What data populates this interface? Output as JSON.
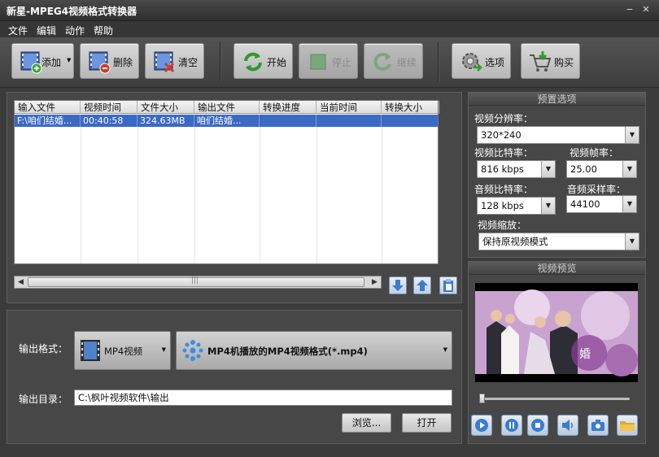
{
  "window": {
    "title": "新星-MPEG4视频格式转换器"
  },
  "menu": [
    "文件",
    "编辑",
    "动作",
    "帮助"
  ],
  "toolbar": {
    "add": "添加",
    "delete": "删除",
    "clear": "清空",
    "start": "开始",
    "stop": "停止",
    "resume": "继续",
    "options": "选项",
    "buy": "购买"
  },
  "file_list": {
    "columns": [
      "输入文件",
      "视频时间",
      "文件大小",
      "输出文件",
      "转换进度",
      "当前时间",
      "转换大小"
    ],
    "rows": [
      [
        "F:\\咱们结婚...",
        "00:40:58",
        "324.63MB",
        "咱们结婚...",
        "",
        "",
        ""
      ]
    ]
  },
  "presets": {
    "section_title": "预置选项",
    "resolution_label": "视频分辨率：",
    "resolution_value": "320*240",
    "video_bitrate_label": "视频比特率：",
    "video_bitrate_value": "816 kbps",
    "frame_rate_label": "视频帧率：",
    "frame_rate_value": "25.00",
    "audio_bitrate_label": "音频比特率：",
    "audio_bitrate_value": "128 kbps",
    "sample_rate_label": "音频采样率：",
    "sample_rate_value": "44100",
    "zoom_label": "视频缩放：",
    "zoom_value": "保持原视频模式"
  },
  "preview": {
    "section_title": "视频预览",
    "slider_position": 0.0
  },
  "output": {
    "format_label": "输出格式：",
    "format_category": "MP4视频",
    "format_detail": "MP4机播放的MP4视频格式(*.mp4)",
    "dir_label": "输出目录：",
    "dir_value": "C:\\枫叶视频软件\\输出",
    "browse": "浏览...",
    "open": "打开"
  },
  "colors": {
    "selection": "#3a6ac4",
    "background": "#3b3b3b"
  }
}
